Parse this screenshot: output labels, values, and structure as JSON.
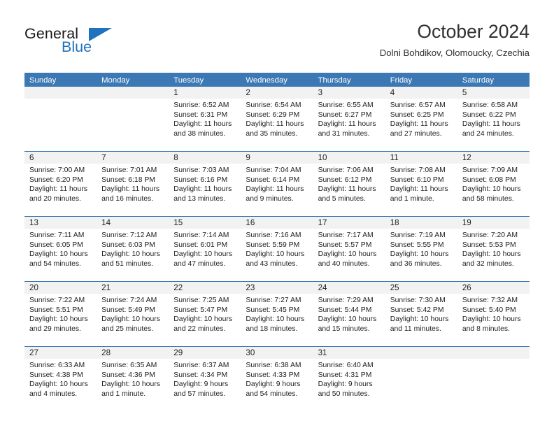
{
  "logo": {
    "word1": "General",
    "word2": "Blue",
    "triangle_color": "#1f72bd"
  },
  "header": {
    "title": "October 2024",
    "subtitle": "Dolni Bohdikov, Olomoucky, Czechia"
  },
  "theme": {
    "accent": "#3c78b4",
    "date_band": "#f2f2f2",
    "text": "#222222"
  },
  "calendar": {
    "weekdays": [
      "Sunday",
      "Monday",
      "Tuesday",
      "Wednesday",
      "Thursday",
      "Friday",
      "Saturday"
    ],
    "weeks": [
      [
        {
          "day": "",
          "sunrise": "",
          "sunset": "",
          "daylight1": "",
          "daylight2": ""
        },
        {
          "day": "",
          "sunrise": "",
          "sunset": "",
          "daylight1": "",
          "daylight2": ""
        },
        {
          "day": "1",
          "sunrise": "Sunrise: 6:52 AM",
          "sunset": "Sunset: 6:31 PM",
          "daylight1": "Daylight: 11 hours",
          "daylight2": "and 38 minutes."
        },
        {
          "day": "2",
          "sunrise": "Sunrise: 6:54 AM",
          "sunset": "Sunset: 6:29 PM",
          "daylight1": "Daylight: 11 hours",
          "daylight2": "and 35 minutes."
        },
        {
          "day": "3",
          "sunrise": "Sunrise: 6:55 AM",
          "sunset": "Sunset: 6:27 PM",
          "daylight1": "Daylight: 11 hours",
          "daylight2": "and 31 minutes."
        },
        {
          "day": "4",
          "sunrise": "Sunrise: 6:57 AM",
          "sunset": "Sunset: 6:25 PM",
          "daylight1": "Daylight: 11 hours",
          "daylight2": "and 27 minutes."
        },
        {
          "day": "5",
          "sunrise": "Sunrise: 6:58 AM",
          "sunset": "Sunset: 6:22 PM",
          "daylight1": "Daylight: 11 hours",
          "daylight2": "and 24 minutes."
        }
      ],
      [
        {
          "day": "6",
          "sunrise": "Sunrise: 7:00 AM",
          "sunset": "Sunset: 6:20 PM",
          "daylight1": "Daylight: 11 hours",
          "daylight2": "and 20 minutes."
        },
        {
          "day": "7",
          "sunrise": "Sunrise: 7:01 AM",
          "sunset": "Sunset: 6:18 PM",
          "daylight1": "Daylight: 11 hours",
          "daylight2": "and 16 minutes."
        },
        {
          "day": "8",
          "sunrise": "Sunrise: 7:03 AM",
          "sunset": "Sunset: 6:16 PM",
          "daylight1": "Daylight: 11 hours",
          "daylight2": "and 13 minutes."
        },
        {
          "day": "9",
          "sunrise": "Sunrise: 7:04 AM",
          "sunset": "Sunset: 6:14 PM",
          "daylight1": "Daylight: 11 hours",
          "daylight2": "and 9 minutes."
        },
        {
          "day": "10",
          "sunrise": "Sunrise: 7:06 AM",
          "sunset": "Sunset: 6:12 PM",
          "daylight1": "Daylight: 11 hours",
          "daylight2": "and 5 minutes."
        },
        {
          "day": "11",
          "sunrise": "Sunrise: 7:08 AM",
          "sunset": "Sunset: 6:10 PM",
          "daylight1": "Daylight: 11 hours",
          "daylight2": "and 1 minute."
        },
        {
          "day": "12",
          "sunrise": "Sunrise: 7:09 AM",
          "sunset": "Sunset: 6:08 PM",
          "daylight1": "Daylight: 10 hours",
          "daylight2": "and 58 minutes."
        }
      ],
      [
        {
          "day": "13",
          "sunrise": "Sunrise: 7:11 AM",
          "sunset": "Sunset: 6:05 PM",
          "daylight1": "Daylight: 10 hours",
          "daylight2": "and 54 minutes."
        },
        {
          "day": "14",
          "sunrise": "Sunrise: 7:12 AM",
          "sunset": "Sunset: 6:03 PM",
          "daylight1": "Daylight: 10 hours",
          "daylight2": "and 51 minutes."
        },
        {
          "day": "15",
          "sunrise": "Sunrise: 7:14 AM",
          "sunset": "Sunset: 6:01 PM",
          "daylight1": "Daylight: 10 hours",
          "daylight2": "and 47 minutes."
        },
        {
          "day": "16",
          "sunrise": "Sunrise: 7:16 AM",
          "sunset": "Sunset: 5:59 PM",
          "daylight1": "Daylight: 10 hours",
          "daylight2": "and 43 minutes."
        },
        {
          "day": "17",
          "sunrise": "Sunrise: 7:17 AM",
          "sunset": "Sunset: 5:57 PM",
          "daylight1": "Daylight: 10 hours",
          "daylight2": "and 40 minutes."
        },
        {
          "day": "18",
          "sunrise": "Sunrise: 7:19 AM",
          "sunset": "Sunset: 5:55 PM",
          "daylight1": "Daylight: 10 hours",
          "daylight2": "and 36 minutes."
        },
        {
          "day": "19",
          "sunrise": "Sunrise: 7:20 AM",
          "sunset": "Sunset: 5:53 PM",
          "daylight1": "Daylight: 10 hours",
          "daylight2": "and 32 minutes."
        }
      ],
      [
        {
          "day": "20",
          "sunrise": "Sunrise: 7:22 AM",
          "sunset": "Sunset: 5:51 PM",
          "daylight1": "Daylight: 10 hours",
          "daylight2": "and 29 minutes."
        },
        {
          "day": "21",
          "sunrise": "Sunrise: 7:24 AM",
          "sunset": "Sunset: 5:49 PM",
          "daylight1": "Daylight: 10 hours",
          "daylight2": "and 25 minutes."
        },
        {
          "day": "22",
          "sunrise": "Sunrise: 7:25 AM",
          "sunset": "Sunset: 5:47 PM",
          "daylight1": "Daylight: 10 hours",
          "daylight2": "and 22 minutes."
        },
        {
          "day": "23",
          "sunrise": "Sunrise: 7:27 AM",
          "sunset": "Sunset: 5:45 PM",
          "daylight1": "Daylight: 10 hours",
          "daylight2": "and 18 minutes."
        },
        {
          "day": "24",
          "sunrise": "Sunrise: 7:29 AM",
          "sunset": "Sunset: 5:44 PM",
          "daylight1": "Daylight: 10 hours",
          "daylight2": "and 15 minutes."
        },
        {
          "day": "25",
          "sunrise": "Sunrise: 7:30 AM",
          "sunset": "Sunset: 5:42 PM",
          "daylight1": "Daylight: 10 hours",
          "daylight2": "and 11 minutes."
        },
        {
          "day": "26",
          "sunrise": "Sunrise: 7:32 AM",
          "sunset": "Sunset: 5:40 PM",
          "daylight1": "Daylight: 10 hours",
          "daylight2": "and 8 minutes."
        }
      ],
      [
        {
          "day": "27",
          "sunrise": "Sunrise: 6:33 AM",
          "sunset": "Sunset: 4:38 PM",
          "daylight1": "Daylight: 10 hours",
          "daylight2": "and 4 minutes."
        },
        {
          "day": "28",
          "sunrise": "Sunrise: 6:35 AM",
          "sunset": "Sunset: 4:36 PM",
          "daylight1": "Daylight: 10 hours",
          "daylight2": "and 1 minute."
        },
        {
          "day": "29",
          "sunrise": "Sunrise: 6:37 AM",
          "sunset": "Sunset: 4:34 PM",
          "daylight1": "Daylight: 9 hours",
          "daylight2": "and 57 minutes."
        },
        {
          "day": "30",
          "sunrise": "Sunrise: 6:38 AM",
          "sunset": "Sunset: 4:33 PM",
          "daylight1": "Daylight: 9 hours",
          "daylight2": "and 54 minutes."
        },
        {
          "day": "31",
          "sunrise": "Sunrise: 6:40 AM",
          "sunset": "Sunset: 4:31 PM",
          "daylight1": "Daylight: 9 hours",
          "daylight2": "and 50 minutes."
        },
        {
          "day": "",
          "sunrise": "",
          "sunset": "",
          "daylight1": "",
          "daylight2": ""
        },
        {
          "day": "",
          "sunrise": "",
          "sunset": "",
          "daylight1": "",
          "daylight2": ""
        }
      ]
    ]
  }
}
